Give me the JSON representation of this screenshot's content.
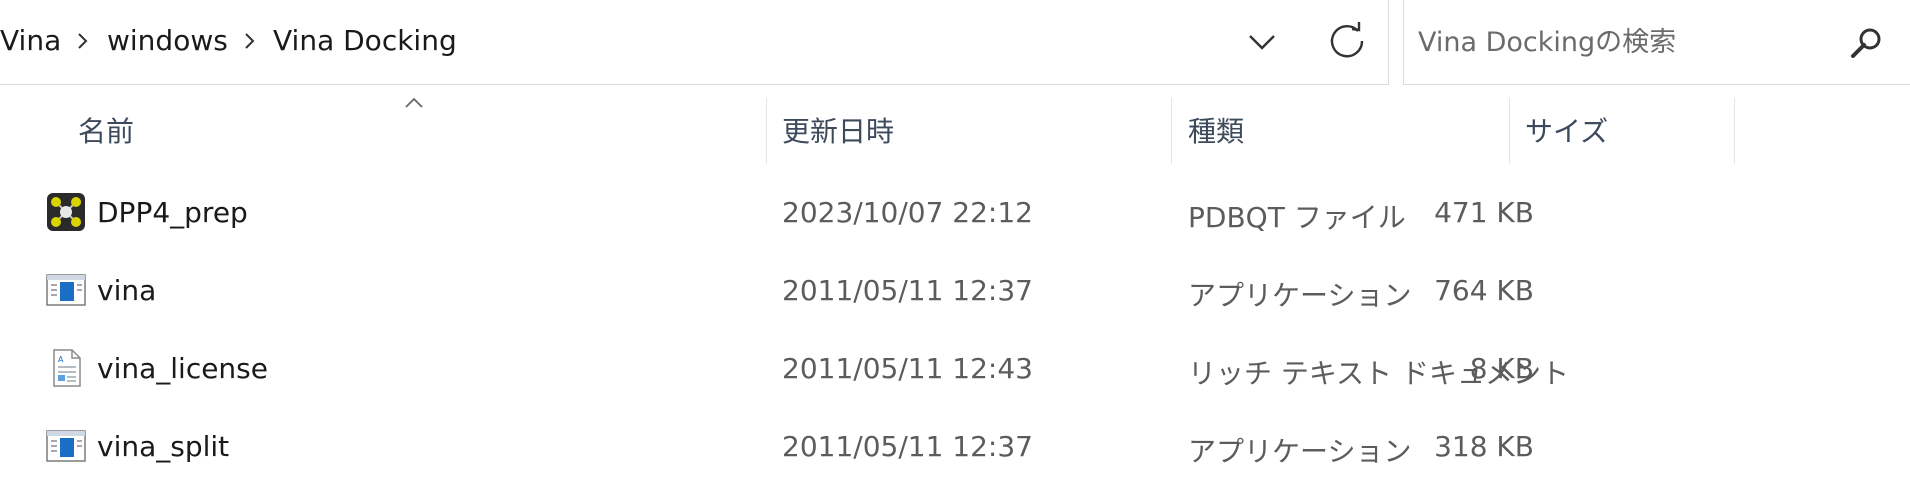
{
  "breadcrumb": {
    "items": [
      "Vina",
      "windows",
      "Vina Docking"
    ]
  },
  "search": {
    "placeholder": "Vina Dockingの検索"
  },
  "columns": {
    "name": "名前",
    "date": "更新日時",
    "type": "種類",
    "size": "サイズ"
  },
  "files": [
    {
      "name": "DPP4_prep",
      "date": "2023/10/07 22:12",
      "type": "PDBQT ファイル",
      "size": "471 KB",
      "icon": "molecule-file-icon"
    },
    {
      "name": "vina",
      "date": "2011/05/11 12:37",
      "type": "アプリケーション",
      "size": "764 KB",
      "icon": "application-icon"
    },
    {
      "name": "vina_license",
      "date": "2011/05/11 12:43",
      "type": "リッチ テキスト ドキュメント",
      "size": "8 KB",
      "icon": "rich-text-document-icon"
    },
    {
      "name": "vina_split",
      "date": "2011/05/11 12:37",
      "type": "アプリケーション",
      "size": "318 KB",
      "icon": "application-icon"
    }
  ]
}
